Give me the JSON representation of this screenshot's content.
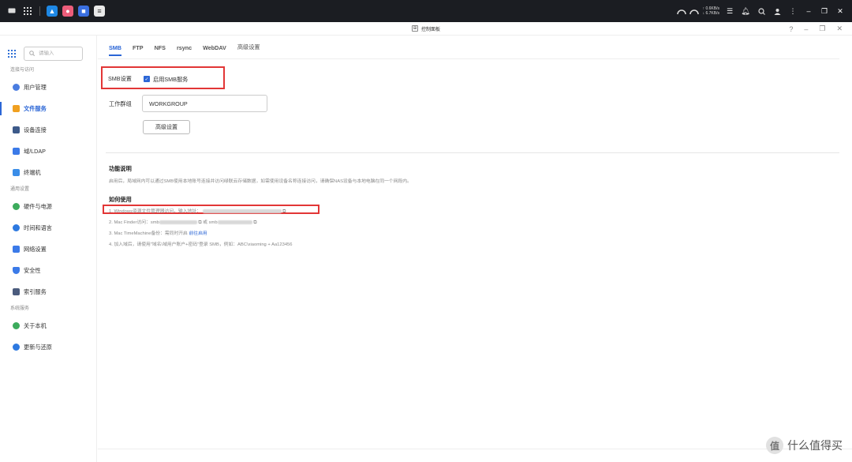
{
  "taskbar": {
    "speed_up": "↑ 0.6KB/s",
    "speed_down": "↓ 6.7KB/s"
  },
  "window": {
    "title": "控制面板"
  },
  "sidebar": {
    "search_placeholder": "请输入",
    "sections": [
      {
        "label": "连接与访问"
      },
      {
        "label": "通用设置"
      },
      {
        "label": "系统服务"
      }
    ],
    "items": [
      {
        "label": "用户管理",
        "color": "#4a7de0"
      },
      {
        "label": "文件服务",
        "color": "#f0a020"
      },
      {
        "label": "设备连接",
        "color": "#3d5a8a"
      },
      {
        "label": "域/LDAP",
        "color": "#3b7ae8"
      },
      {
        "label": "终端机",
        "color": "#3a8de8"
      },
      {
        "label": "硬件与电源",
        "color": "#3cab5c"
      },
      {
        "label": "时间和语言",
        "color": "#2d79e0"
      },
      {
        "label": "网络设置",
        "color": "#3b7ae8"
      },
      {
        "label": "安全性",
        "color": "#3b7ae8"
      },
      {
        "label": "索引服务",
        "color": "#4b5b7d"
      },
      {
        "label": "关于本机",
        "color": "#3cab5c"
      },
      {
        "label": "更新与还原",
        "color": "#2d79e0"
      }
    ]
  },
  "tabs": [
    "SMB",
    "FTP",
    "NFS",
    "rsync",
    "WebDAV",
    "高级设置"
  ],
  "smb": {
    "setting_label": "SMB设置",
    "enable_label": "启用SMB服务",
    "workgroup_label": "工作群组",
    "workgroup_value": "WORKGROUP",
    "advanced_button": "高级设置"
  },
  "info": {
    "function_title": "功能说明",
    "function_text": "启用后，局域网内可以通过SMB使用本地账号连接并访问绿联云存储数据，如需使用设备名称连接访问，请确保NAS设备与本地电脑在同一个网段内。",
    "usage_title": "如何使用",
    "usage_1": "1. Windows资源文件管理器访问，输入地址：",
    "usage_2a": "2. Mac Finder访问：smb",
    "usage_2b": "或",
    "usage_2c": "smb",
    "usage_3": "3. Mac TimeMachine备份：需同时开启",
    "usage_3_link": "前往启用",
    "usage_4": "4. 加入域后，请使用\"域名\\域用户账户+密码\"登录 SMB，例如：ABC\\xiaoming + Aa123456"
  },
  "watermark": {
    "text": "什么值得买"
  },
  "colors": {
    "accent": "#2b66d6",
    "highlight": "#e23636"
  }
}
